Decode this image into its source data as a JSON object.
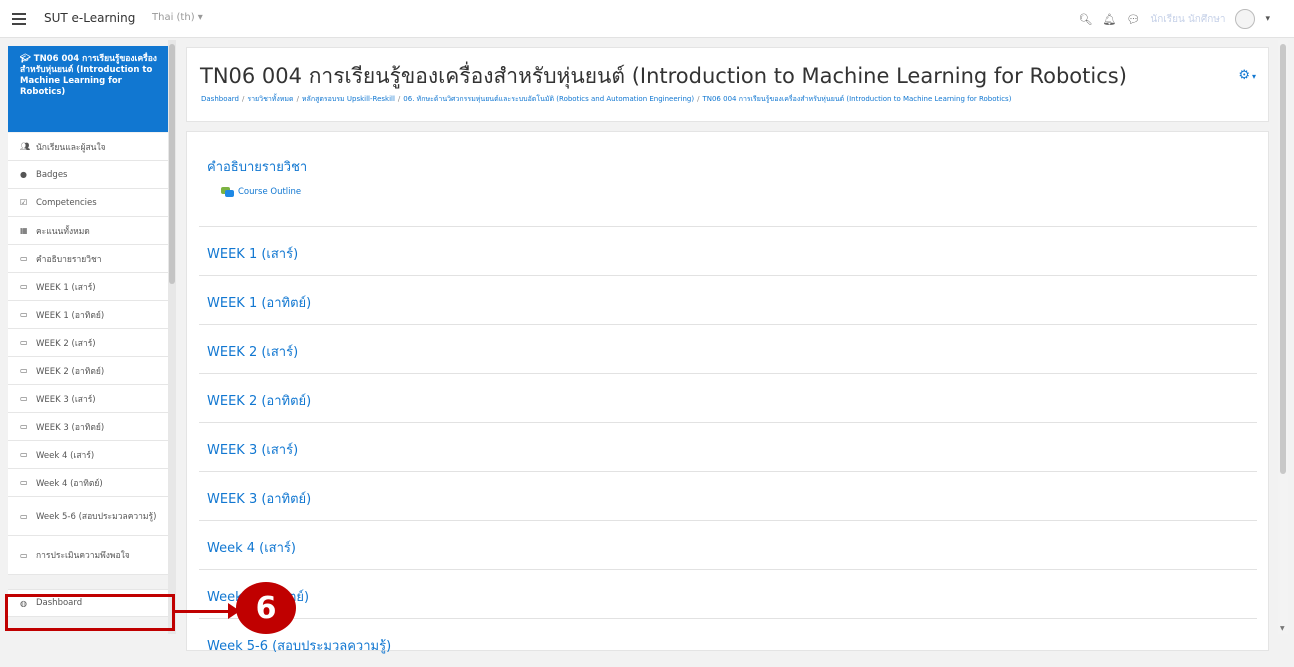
{
  "navbar": {
    "site_name": "SUT e-Learning",
    "language": "Thai (th)",
    "search_icon": "search-icon",
    "bell_icon": "bell-icon",
    "message_icon": "message-icon",
    "user_name": "นักเรียน นักศึกษา"
  },
  "drawer": {
    "course_short": "TN06 004 การเรียนรู้ของเครื่องสำหรับหุ่นยนต์ (Introduction to Machine Learning for Robotics)",
    "items": [
      {
        "label": "นักเรียนและผู้สนใจ",
        "icon": "users-icon"
      },
      {
        "label": "Badges",
        "icon": "shield-icon"
      },
      {
        "label": "Competencies",
        "icon": "check-square-icon"
      },
      {
        "label": "คะแนนทั้งหมด",
        "icon": "table-icon"
      },
      {
        "label": "คำอธิบายรายวิชา",
        "icon": "folder-icon"
      },
      {
        "label": "WEEK 1 (เสาร์)",
        "icon": "folder-icon"
      },
      {
        "label": "WEEK 1 (อาทิตย์)",
        "icon": "folder-icon"
      },
      {
        "label": "WEEK 2 (เสาร์)",
        "icon": "folder-icon"
      },
      {
        "label": "WEEK 2 (อาทิตย์)",
        "icon": "folder-icon"
      },
      {
        "label": "WEEK 3 (เสาร์)",
        "icon": "folder-icon"
      },
      {
        "label": "WEEK 3 (อาทิตย์)",
        "icon": "folder-icon"
      },
      {
        "label": "Week 4 (เสาร์)",
        "icon": "folder-icon"
      },
      {
        "label": "Week 4 (อาทิตย์)",
        "icon": "folder-icon"
      },
      {
        "label": "Week 5-6 (สอบประมวลความรู้)",
        "icon": "folder-icon"
      },
      {
        "label": "การประเมินความพึงพอใจ",
        "icon": "folder-icon"
      }
    ],
    "dashboard_label": "Dashboard",
    "dashboard_icon": "dashboard-icon"
  },
  "header": {
    "title": "TN06 004 การเรียนรู้ของเครื่องสำหรับหุ่นยนต์ (Introduction to Machine Learning for Robotics)",
    "breadcrumb": [
      "Dashboard",
      "รายวิชาทั้งหมด",
      "หลักสูตรอบรม Upskill-Reskill",
      "06. ทักษะด้านวิศวกรรมหุ่นยนต์และระบบอัตโนมัติ (Robotics and Automation Engineering)",
      "TN06 004 การเรียนรู้ของเครื่องสำหรับหุ่นยนต์ (Introduction to Machine Learning for Robotics)"
    ],
    "gear_icon": "gear-icon"
  },
  "content": {
    "intro_title": "คำอธิบายรายวิชา",
    "course_outline": "Course Outline",
    "weeks": [
      "WEEK 1 (เสาร์)",
      "WEEK 1 (อาทิตย์)",
      "WEEK 2 (เสาร์)",
      "WEEK 2 (อาทิตย์)",
      "WEEK 3 (เสาร์)",
      "WEEK 3 (อาทิตย์)",
      "Week 4 (เสาร์)",
      "Week 4 (อาทิตย์)",
      "Week 5-6 (สอบประมวลความรู้)"
    ]
  },
  "annotation": {
    "step_number": "6",
    "color": "#c00000"
  },
  "colors": {
    "accent": "#1177d1",
    "background": "#f2f2f2"
  }
}
